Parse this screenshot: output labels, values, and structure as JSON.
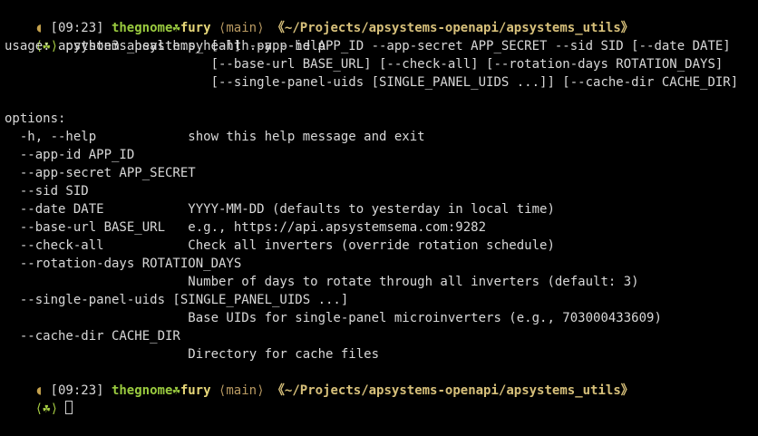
{
  "colors": {
    "background": "#000000",
    "text": "#d8d8d8",
    "user": "#9acb3f",
    "host": "#e8d879",
    "path": "#d7c07a",
    "branch": "#b99a62",
    "clock": "#c5a14d"
  },
  "prompt1": {
    "clock_icon": "◖",
    "time": "[09:23]",
    "user": "thegnome",
    "separator": "☘",
    "host": "fury",
    "branch": "⟨main⟩",
    "path": "《~/Projects/apsystems-openapi/apsystems_utils》"
  },
  "command_line": {
    "prompt_symbol": "⟨☘⟩",
    "command": "python3 apsystems_health.py --help"
  },
  "output": [
    "usage: apsystems_health.py [-h] --app-id APP_ID --app-secret APP_SECRET --sid SID [--date DATE]",
    "                           [--base-url BASE_URL] [--check-all] [--rotation-days ROTATION_DAYS]",
    "                           [--single-panel-uids [SINGLE_PANEL_UIDS ...]] [--cache-dir CACHE_DIR]",
    "",
    "options:",
    "  -h, --help            show this help message and exit",
    "  --app-id APP_ID",
    "  --app-secret APP_SECRET",
    "  --sid SID",
    "  --date DATE           YYYY-MM-DD (defaults to yesterday in local time)",
    "  --base-url BASE_URL   e.g., https://api.apsystemsema.com:9282",
    "  --check-all           Check all inverters (override rotation schedule)",
    "  --rotation-days ROTATION_DAYS",
    "                        Number of days to rotate through all inverters (default: 3)",
    "  --single-panel-uids [SINGLE_PANEL_UIDS ...]",
    "                        Base UIDs for single-panel microinverters (e.g., 703000433609)",
    "  --cache-dir CACHE_DIR",
    "                        Directory for cache files"
  ],
  "prompt2": {
    "clock_icon": "◖",
    "time": "[09:23]",
    "user": "thegnome",
    "separator": "☘",
    "host": "fury",
    "branch": "⟨main⟩",
    "path": "《~/Projects/apsystems-openapi/apsystems_utils》"
  },
  "input_line": {
    "prompt_symbol": "⟨☘⟩",
    "current_input": ""
  }
}
